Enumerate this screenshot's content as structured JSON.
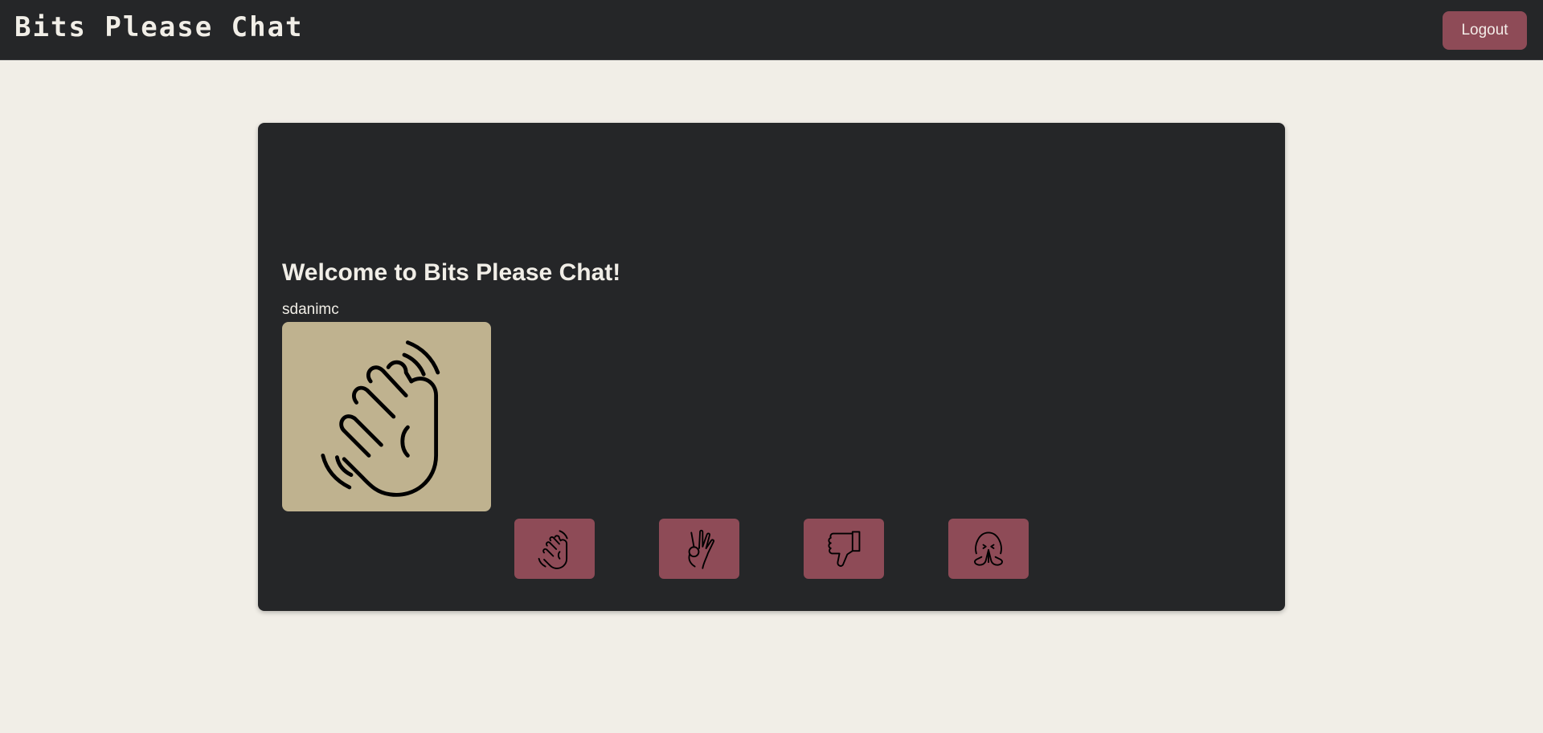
{
  "header": {
    "app_title": "Bits Please Chat",
    "logout_label": "Logout"
  },
  "main": {
    "welcome_heading": "Welcome to Bits Please Chat!",
    "username": "sdanimc",
    "avatar_icon": "waving-hand-icon",
    "reactions": [
      {
        "icon": "waving-hand-icon"
      },
      {
        "icon": "ok-hand-icon"
      },
      {
        "icon": "thumbs-down-icon"
      },
      {
        "icon": "face-palms-together-icon"
      }
    ]
  },
  "colors": {
    "page_bg": "#f1eee7",
    "surface": "#252628",
    "accent": "#8e4b57",
    "avatar_bg": "#bfb28f",
    "text_light": "#f1eee7"
  }
}
